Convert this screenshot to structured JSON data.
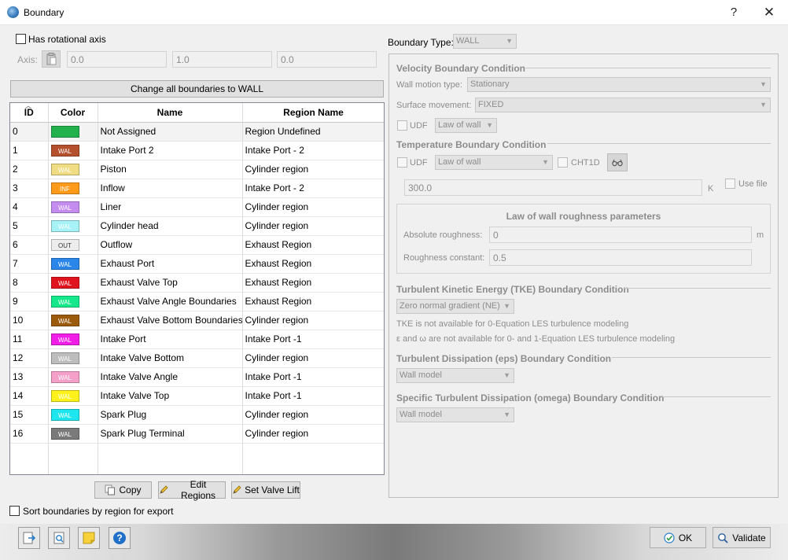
{
  "window": {
    "title": "Boundary",
    "help": "?",
    "close": "✕"
  },
  "rotational": {
    "label": "Has rotational axis",
    "axis_label": "Axis:",
    "values": [
      "0.0",
      "1.0",
      "0.0"
    ]
  },
  "change_all_button": "Change all boundaries to WALL",
  "table": {
    "columns": [
      "ID",
      "Color",
      "Name",
      "Region Name"
    ],
    "rows": [
      {
        "id": "0",
        "chip": "",
        "color": "#22b14c",
        "name": "Not Assigned",
        "region": "Region Undefined"
      },
      {
        "id": "1",
        "chip": "WAL",
        "color": "#b5502e",
        "name": "Intake Port 2",
        "region": "Intake Port - 2"
      },
      {
        "id": "2",
        "chip": "WAL",
        "color": "#f0dc82",
        "name": "Piston",
        "region": "Cylinder region"
      },
      {
        "id": "3",
        "chip": "INF",
        "color": "#ff9a1a",
        "name": "Inflow",
        "region": "Intake Port - 2"
      },
      {
        "id": "4",
        "chip": "WAL",
        "color": "#c58cf0",
        "name": "Liner",
        "region": "Cylinder region"
      },
      {
        "id": "5",
        "chip": "WAL",
        "color": "#a6f2f7",
        "name": "Cylinder head",
        "region": "Cylinder region"
      },
      {
        "id": "6",
        "chip": "OUT",
        "color": "#ededed",
        "name": "Outflow",
        "region": "Exhaust Region"
      },
      {
        "id": "7",
        "chip": "WAL",
        "color": "#2a86e8",
        "name": "Exhaust Port",
        "region": "Exhaust Region"
      },
      {
        "id": "8",
        "chip": "WAL",
        "color": "#e0141e",
        "name": "Exhaust Valve Top",
        "region": "Exhaust Region"
      },
      {
        "id": "9",
        "chip": "WAL",
        "color": "#14e88a",
        "name": "Exhaust Valve Angle Boundaries",
        "region": "Exhaust Region"
      },
      {
        "id": "10",
        "chip": "WAL",
        "color": "#9c5a0c",
        "name": "Exhaust Valve Bottom Boundaries",
        "region": "Cylinder region"
      },
      {
        "id": "11",
        "chip": "WAL",
        "color": "#f01ee6",
        "name": "Intake Port",
        "region": "Intake Port -1"
      },
      {
        "id": "12",
        "chip": "WAL",
        "color": "#bdbdbd",
        "name": "Intake Valve Bottom",
        "region": "Cylinder region"
      },
      {
        "id": "13",
        "chip": "WAL",
        "color": "#f5a0c8",
        "name": "Intake Valve Angle",
        "region": "Intake Port -1"
      },
      {
        "id": "14",
        "chip": "WAL",
        "color": "#fff21c",
        "name": "Intake Valve Top",
        "region": "Intake Port -1"
      },
      {
        "id": "15",
        "chip": "WAL",
        "color": "#1ee6ef",
        "name": "Spark Plug",
        "region": "Cylinder region"
      },
      {
        "id": "16",
        "chip": "WAL",
        "color": "#7a7a7a",
        "name": "Spark Plug Terminal",
        "region": "Cylinder region"
      }
    ]
  },
  "buttons": {
    "copy": "Copy",
    "edit_regions": "Edit Regions",
    "set_valve_lift": "Set Valve Lift"
  },
  "sort_label": "Sort boundaries by region for export",
  "boundary_type": {
    "label": "Boundary Type:",
    "value": "WALL"
  },
  "velocity": {
    "title": "Velocity Boundary Condition",
    "wall_motion_label": "Wall motion type:",
    "wall_motion_value": "Stationary",
    "surface_label": "Surface movement:",
    "surface_value": "FIXED",
    "udf_label": "UDF",
    "law_value": "Law of wall"
  },
  "temperature": {
    "title": "Temperature Boundary Condition",
    "udf_label": "UDF",
    "law_value": "Law of wall",
    "cht_label": "CHT1D",
    "value": "300.0",
    "unit": "K",
    "use_file_label": "Use file"
  },
  "roughness": {
    "title": "Law of wall roughness parameters",
    "abs_label": "Absolute roughness:",
    "abs_value": "0",
    "abs_unit": "m",
    "const_label": "Roughness constant:",
    "const_value": "0.5"
  },
  "tke": {
    "title": "Turbulent Kinetic Energy (TKE) Boundary Condition",
    "value": "Zero normal gradient (NE)",
    "note1": "TKE is not available for 0-Equation LES turbulence modeling",
    "note2": "ε and ω are not available for 0- and 1-Equation LES turbulence modeling"
  },
  "eps": {
    "title": "Turbulent Dissipation (eps) Boundary Condition",
    "value": "Wall model"
  },
  "omega": {
    "title": "Specific Turbulent Dissipation (omega) Boundary Condition",
    "value": "Wall model"
  },
  "footer": {
    "ok": "OK",
    "validate": "Validate"
  },
  "icons": [
    "export-icon",
    "preview-icon",
    "note-icon",
    "help-icon"
  ]
}
